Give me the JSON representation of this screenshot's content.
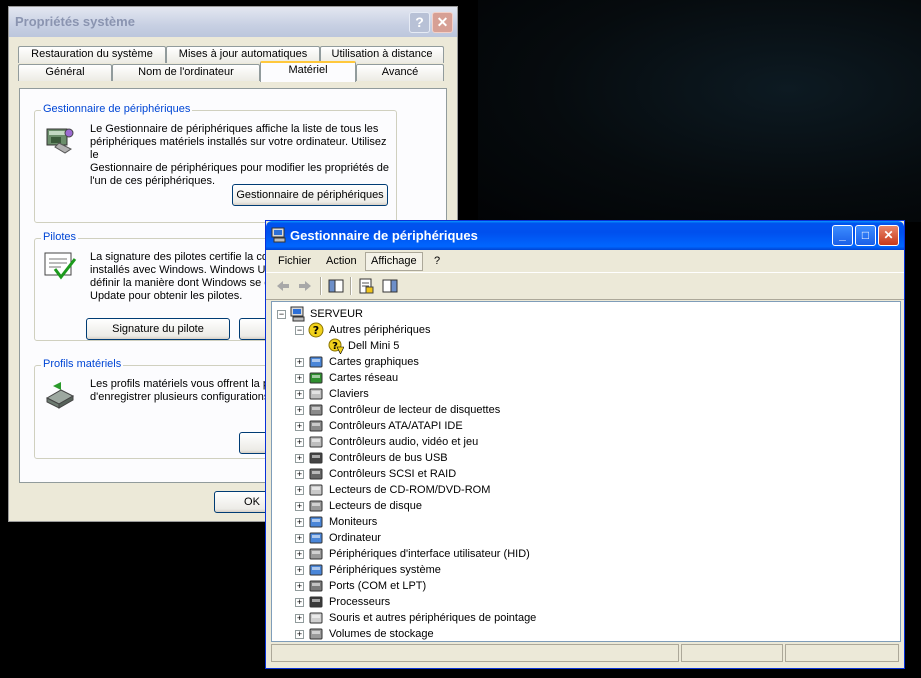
{
  "system_properties": {
    "title": "Propriétés système",
    "tabs_row1": [
      "Restauration du système",
      "Mises à jour automatiques",
      "Utilisation à distance"
    ],
    "tabs_row2": [
      "Général",
      "Nom de l'ordinateur",
      "Matériel",
      "Avancé"
    ],
    "active_tab": "Matériel",
    "groups": {
      "device_manager": {
        "title": "Gestionnaire de périphériques",
        "lines": [
          "Le Gestionnaire de périphériques affiche la liste de tous les",
          "périphériques matériels installés sur votre ordinateur. Utilisez le",
          "Gestionnaire de périphériques pour modifier les propriétés de",
          "l'un de ces périphériques."
        ],
        "button": "Gestionnaire de périphériques"
      },
      "drivers": {
        "title": "Pilotes",
        "lines": [
          "La signature des pilotes certifie la cor",
          "installés avec Windows. Windows Up",
          "définir la manière dont Windows se co",
          "Update pour obtenir les pilotes."
        ],
        "button": "Signature du pilote"
      },
      "hardware_profiles": {
        "title": "Profils matériels",
        "lines": [
          "Les profils matériels vous offrent la po",
          "d'enregistrer plusieurs configurations m"
        ]
      }
    },
    "ok_button": "OK"
  },
  "device_manager": {
    "title": "Gestionnaire de périphériques",
    "menu": [
      "Fichier",
      "Action",
      "Affichage",
      "?"
    ],
    "active_menu": "Affichage",
    "root": "SERVEUR",
    "other_devices": "Autres périphériques",
    "unknown_device": "Dell Mini 5",
    "categories": [
      {
        "label": "Cartes graphiques",
        "icon": "display-adapter-icon"
      },
      {
        "label": "Cartes réseau",
        "icon": "network-card-icon"
      },
      {
        "label": "Claviers",
        "icon": "keyboard-icon"
      },
      {
        "label": "Contrôleur de lecteur de disquettes",
        "icon": "floppy-controller-icon"
      },
      {
        "label": "Contrôleurs ATA/ATAPI IDE",
        "icon": "ide-controller-icon"
      },
      {
        "label": "Contrôleurs audio, vidéo et jeu",
        "icon": "audio-icon"
      },
      {
        "label": "Contrôleurs de bus USB",
        "icon": "usb-icon"
      },
      {
        "label": "Contrôleurs SCSI et RAID",
        "icon": "scsi-icon"
      },
      {
        "label": "Lecteurs de CD-ROM/DVD-ROM",
        "icon": "cdrom-icon"
      },
      {
        "label": "Lecteurs de disque",
        "icon": "disk-drive-icon"
      },
      {
        "label": "Moniteurs",
        "icon": "monitor-icon"
      },
      {
        "label": "Ordinateur",
        "icon": "computer-icon"
      },
      {
        "label": "Périphériques d'interface utilisateur (HID)",
        "icon": "hid-icon"
      },
      {
        "label": "Périphériques système",
        "icon": "system-devices-icon"
      },
      {
        "label": "Ports (COM et LPT)",
        "icon": "ports-icon"
      },
      {
        "label": "Processeurs",
        "icon": "processor-icon"
      },
      {
        "label": "Souris et autres périphériques de pointage",
        "icon": "mouse-icon"
      },
      {
        "label": "Volumes de stockage",
        "icon": "storage-volume-icon"
      }
    ]
  }
}
